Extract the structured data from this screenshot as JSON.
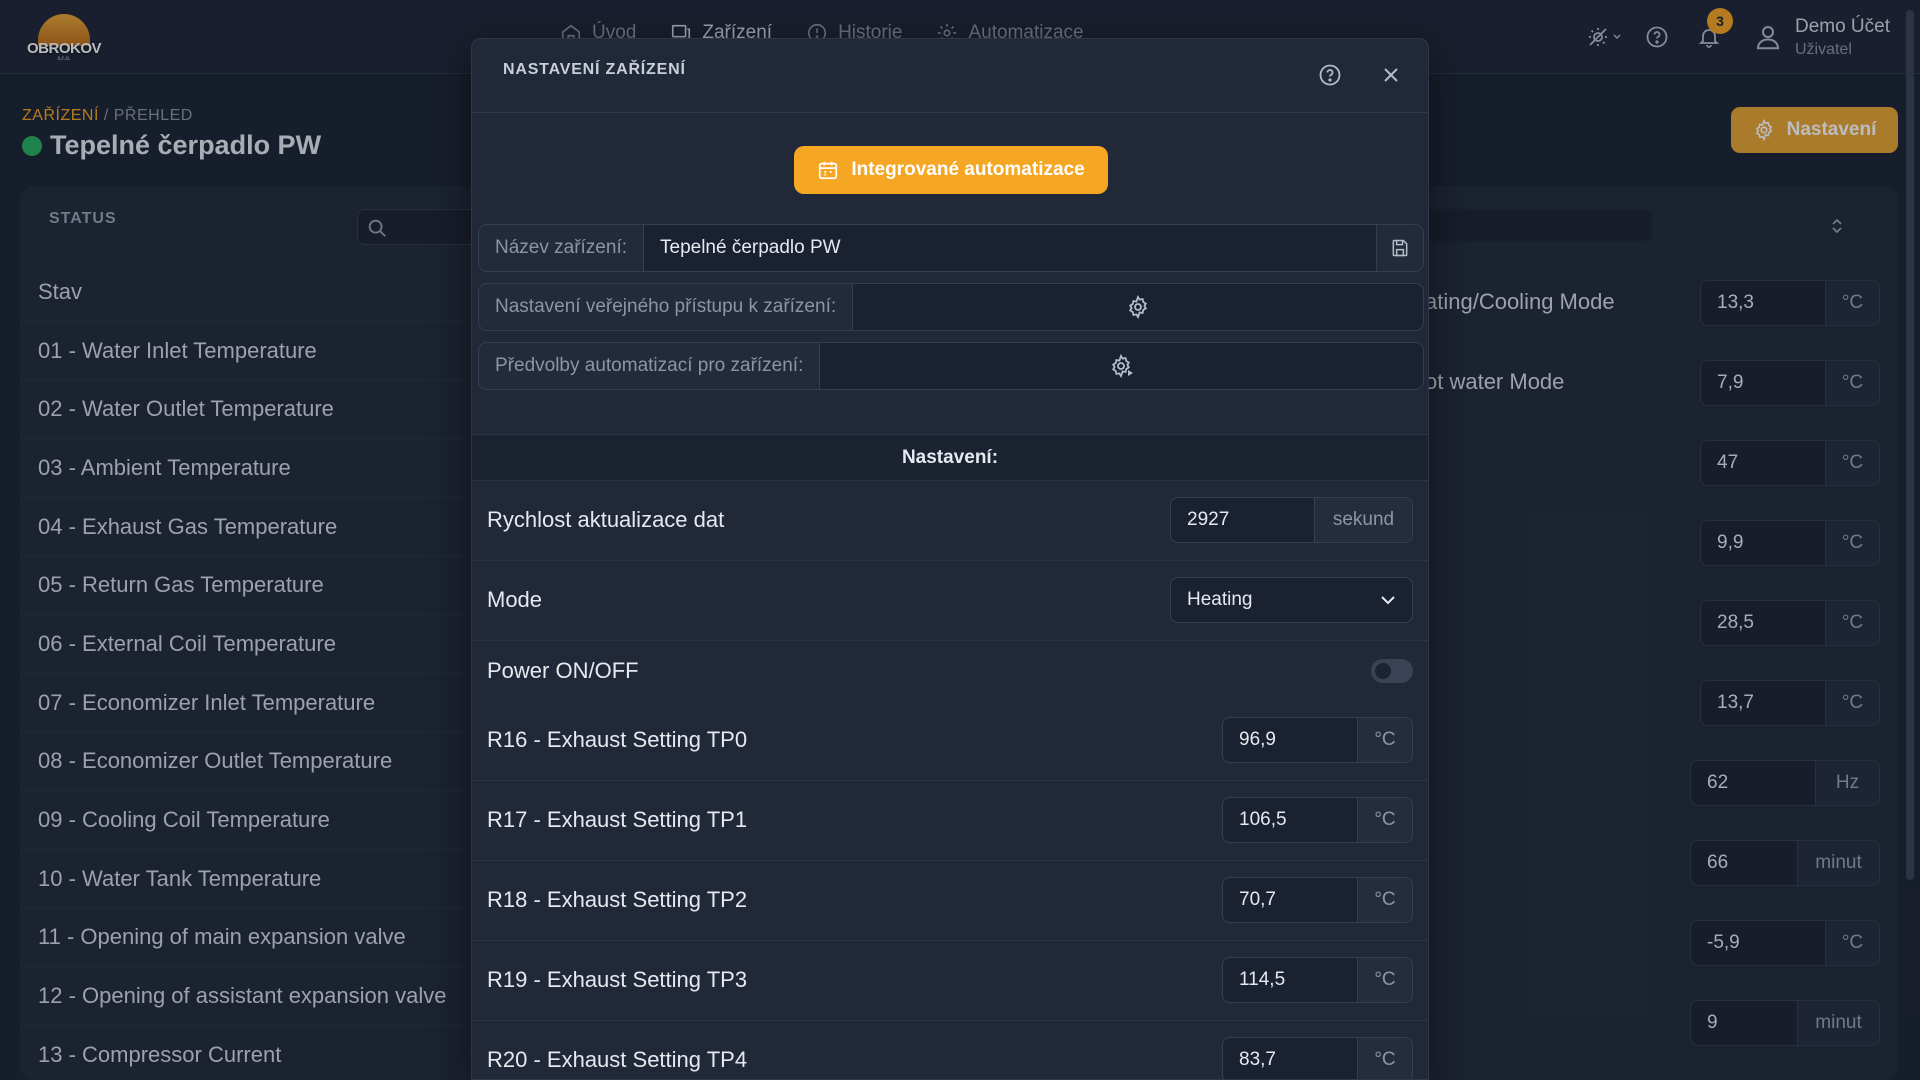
{
  "brand": {
    "name": "OBROKOV",
    "sub": "s.r.o."
  },
  "nav": {
    "items": [
      {
        "label": "Úvod",
        "icon": "home-icon"
      },
      {
        "label": "Zařízení",
        "icon": "device-icon"
      },
      {
        "label": "Historie",
        "icon": "history-icon"
      },
      {
        "label": "Automatizace",
        "icon": "automation-icon"
      }
    ]
  },
  "topbar": {
    "notifications_count": "3"
  },
  "user": {
    "name": "Demo Účet",
    "role": "Uživatel"
  },
  "breadcrumb": {
    "parent": "ZAŘÍZENÍ",
    "separator": "/",
    "current": "PŘEHLED"
  },
  "page": {
    "title": "Tepelné čerpadlo PW",
    "settings_label": "Nastavení",
    "status_color": "#27ae60"
  },
  "status_panel": {
    "heading": "STATUS",
    "rows": [
      "Stav",
      "01 - Water Inlet Temperature",
      "02 - Water Outlet Temperature",
      "03 - Ambient Temperature",
      "04 - Exhaust Gas Temperature",
      "05 - Return Gas Temperature",
      "06 - External Coil Temperature",
      "07 - Economizer Inlet Temperature",
      "08 - Economizer Outlet Temperature",
      "09 - Cooling Coil Temperature",
      "10 - Water Tank Temperature",
      "11 - Opening of main expansion valve",
      "12 - Opening of assistant expansion valve",
      "13 - Compressor Current"
    ]
  },
  "right_panel": {
    "labels": [
      "ating/Cooling Mode",
      "ot water Mode"
    ],
    "values": [
      {
        "value": "13,3",
        "unit": "°C"
      },
      {
        "value": "7,9",
        "unit": "°C"
      },
      {
        "value": "47",
        "unit": "°C"
      },
      {
        "value": "9,9",
        "unit": "°C"
      },
      {
        "value": "28,5",
        "unit": "°C"
      },
      {
        "value": "13,7",
        "unit": "°C"
      },
      {
        "value": "62",
        "unit": "Hz"
      },
      {
        "value": "66",
        "unit": "minut"
      },
      {
        "value": "-5,9",
        "unit": "°C"
      },
      {
        "value": "9",
        "unit": "minut"
      }
    ]
  },
  "modal": {
    "title": "NASTAVENÍ ZAŘÍZENÍ",
    "automation_button": "Integrované automatizace",
    "device_name_label": "Název zařízení:",
    "device_name_value": "Tepelné čerpadlo PW",
    "public_access_label": "Nastavení veřejného přístupu k zařízení:",
    "presets_label": "Předvolby automatizací pro zařízení:",
    "section_title": "Nastavení:",
    "update_rate": {
      "label": "Rychlost aktualizace dat",
      "value": "2927",
      "unit": "sekund"
    },
    "mode": {
      "label": "Mode",
      "selected": "Heating"
    },
    "power": {
      "label": "Power ON/OFF",
      "on": false
    },
    "settings": [
      {
        "label": "R16 - Exhaust Setting TP0",
        "value": "96,9",
        "unit": "°C"
      },
      {
        "label": "R17 - Exhaust Setting TP1",
        "value": "106,5",
        "unit": "°C"
      },
      {
        "label": "R18 - Exhaust Setting TP2",
        "value": "70,7",
        "unit": "°C"
      },
      {
        "label": "R19 - Exhaust Setting TP3",
        "value": "114,5",
        "unit": "°C"
      },
      {
        "label": "R20 - Exhaust Setting TP4",
        "value": "83,7",
        "unit": "°C"
      }
    ]
  },
  "colors": {
    "accent": "#f5a623",
    "background": "#1d2433",
    "panel": "#222a3a",
    "status_ok": "#27ae60"
  }
}
